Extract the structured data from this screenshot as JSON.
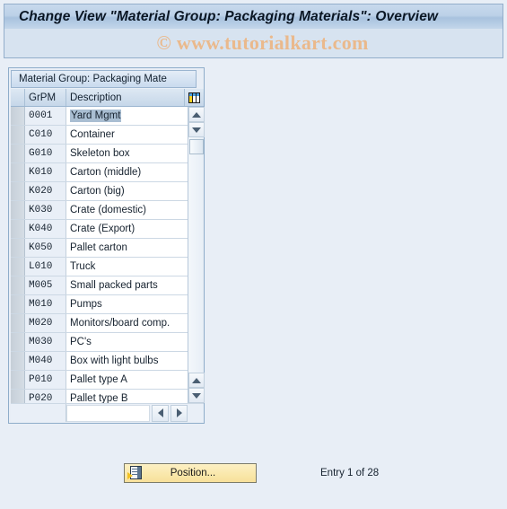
{
  "window": {
    "title": "Change View \"Material Group: Packaging Materials\": Overview",
    "watermark": "© www.tutorialkart.com"
  },
  "panel": {
    "tab_label": "Material Group: Packaging Mate",
    "column_settings_icon": "column-settings-icon"
  },
  "table": {
    "columns": [
      {
        "key": "select",
        "label": ""
      },
      {
        "key": "grpm",
        "label": "GrPM"
      },
      {
        "key": "description",
        "label": "Description"
      }
    ],
    "selected_row_index": 0,
    "rows": [
      {
        "grpm": "0001",
        "description": "Yard Mgmt"
      },
      {
        "grpm": "C010",
        "description": "Container"
      },
      {
        "grpm": "G010",
        "description": "Skeleton box"
      },
      {
        "grpm": "K010",
        "description": "Carton (middle)"
      },
      {
        "grpm": "K020",
        "description": "Carton (big)"
      },
      {
        "grpm": "K030",
        "description": "Crate (domestic)"
      },
      {
        "grpm": "K040",
        "description": "Crate (Export)"
      },
      {
        "grpm": "K050",
        "description": "Pallet carton"
      },
      {
        "grpm": "L010",
        "description": "Truck"
      },
      {
        "grpm": "M005",
        "description": "Small packed parts"
      },
      {
        "grpm": "M010",
        "description": "Pumps"
      },
      {
        "grpm": "M020",
        "description": "Monitors/board comp."
      },
      {
        "grpm": "M030",
        "description": "PC's"
      },
      {
        "grpm": "M040",
        "description": "Box with light bulbs"
      },
      {
        "grpm": "P010",
        "description": "Pallet type A"
      },
      {
        "grpm": "P020",
        "description": "Pallet type B"
      }
    ],
    "footer_field_value": ""
  },
  "scrollbars": {
    "vertical": {
      "up_icon": "scroll-up-arrow-icon",
      "down_icon": "scroll-down-arrow-icon"
    },
    "horizontal": {
      "left_icon": "scroll-left-arrow-icon",
      "right_icon": "scroll-right-arrow-icon"
    }
  },
  "footer": {
    "position_button_label": "Position...",
    "position_button_icon": "position-jump-icon",
    "entry_status": "Entry 1 of 28"
  },
  "colors": {
    "window_background": "#e8eef6",
    "title_bar": "#bcd1e8",
    "panel_border": "#8fadca",
    "watermark": "#eab98c",
    "selection_highlight": "#a9bed2",
    "button_yellow": "#fae9ae"
  }
}
